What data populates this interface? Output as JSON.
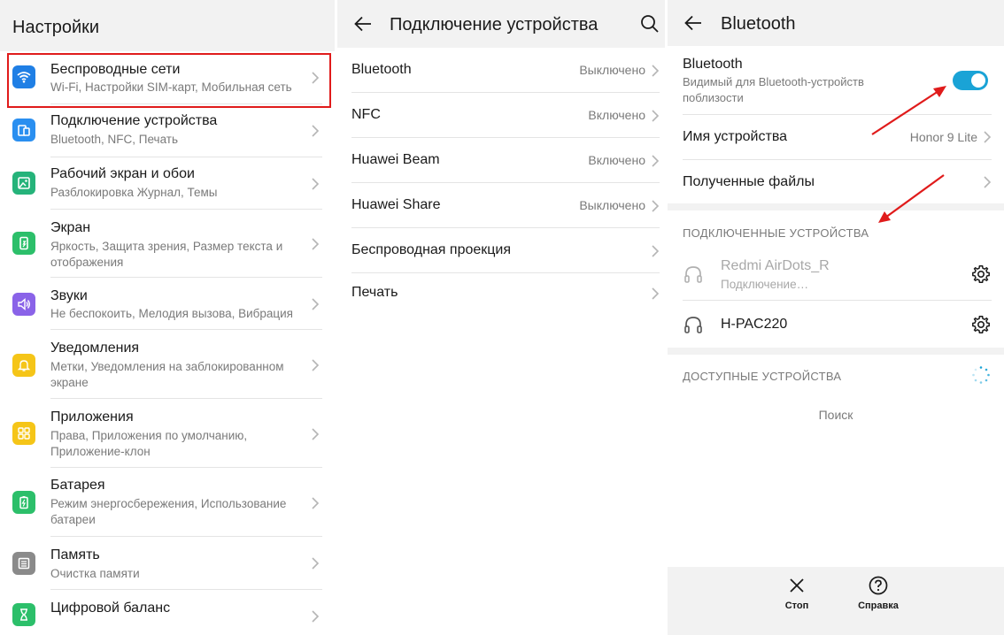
{
  "colors": {
    "highlight": "#e01b1b",
    "toggle_on": "#1aa3d6",
    "arrow": "#e01b1b"
  },
  "settings": {
    "title": "Настройки",
    "items": [
      {
        "icon": "wifi-icon",
        "color": "#1f7fe5",
        "title": "Беспроводные сети",
        "subtitle": "Wi-Fi, Настройки SIM-карт, Мобильная сеть"
      },
      {
        "icon": "device-connection-icon",
        "color": "#2a8ff0",
        "title": "Подключение устройства",
        "subtitle": "Bluetooth, NFC, Печать"
      },
      {
        "icon": "image-icon",
        "color": "#25b37a",
        "title": "Рабочий экран и обои",
        "subtitle": "Разблокировка Журнал, Темы"
      },
      {
        "icon": "phone-brightness-icon",
        "color": "#2cbf6a",
        "title": "Экран",
        "subtitle": "Яркость, Защита зрения, Размер текста и отображения"
      },
      {
        "icon": "speaker-icon",
        "color": "#8a63e8",
        "title": "Звуки",
        "subtitle": "Не беспокоить, Мелодия вызова, Вибрация"
      },
      {
        "icon": "bell-icon",
        "color": "#f5c518",
        "title": "Уведомления",
        "subtitle": "Метки, Уведомления на заблокированном экране"
      },
      {
        "icon": "apps-grid-icon",
        "color": "#f5c518",
        "title": "Приложения",
        "subtitle": "Права, Приложения по умолчанию, Приложение-клон"
      },
      {
        "icon": "battery-icon",
        "color": "#2cbf6a",
        "title": "Батарея",
        "subtitle": "Режим энергосбережения, Использование батареи"
      },
      {
        "icon": "storage-icon",
        "color": "#8a8a8a",
        "title": "Память",
        "subtitle": "Очистка памяти"
      },
      {
        "icon": "hourglass-icon",
        "color": "#2cbf6a",
        "title": "Цифровой баланс",
        "subtitle": ""
      }
    ]
  },
  "device_connection": {
    "title": "Подключение устройства",
    "rows": [
      {
        "label": "Bluetooth",
        "status": "Выключено"
      },
      {
        "label": "NFC",
        "status": "Включено"
      },
      {
        "label": "Huawei Beam",
        "status": "Включено"
      },
      {
        "label": "Huawei Share",
        "status": "Выключено"
      },
      {
        "label": "Беспроводная проекция",
        "status": ""
      },
      {
        "label": "Печать",
        "status": ""
      }
    ]
  },
  "bluetooth": {
    "title": "Bluetooth",
    "toggle_label": "Bluetooth",
    "toggle_sub": "Видимый для Bluetooth-устройств поблизости",
    "toggle_on": true,
    "device_name_label": "Имя устройства",
    "device_name_value": "Honor 9 Lite",
    "received_files_label": "Полученные файлы",
    "connected_header": "ПОДКЛЮЧЕННЫЕ УСТРОЙСТВА",
    "connected": [
      {
        "name": "Redmi AirDots_R",
        "status": "Подключение…",
        "dimmed": true
      },
      {
        "name": "H-PAC220",
        "status": "",
        "dimmed": false
      }
    ],
    "available_header": "ДОСТУПНЫЕ УСТРОЙСТВА",
    "searching_text": "Поиск",
    "bottom": {
      "stop_label": "Стоп",
      "help_label": "Справка"
    }
  }
}
